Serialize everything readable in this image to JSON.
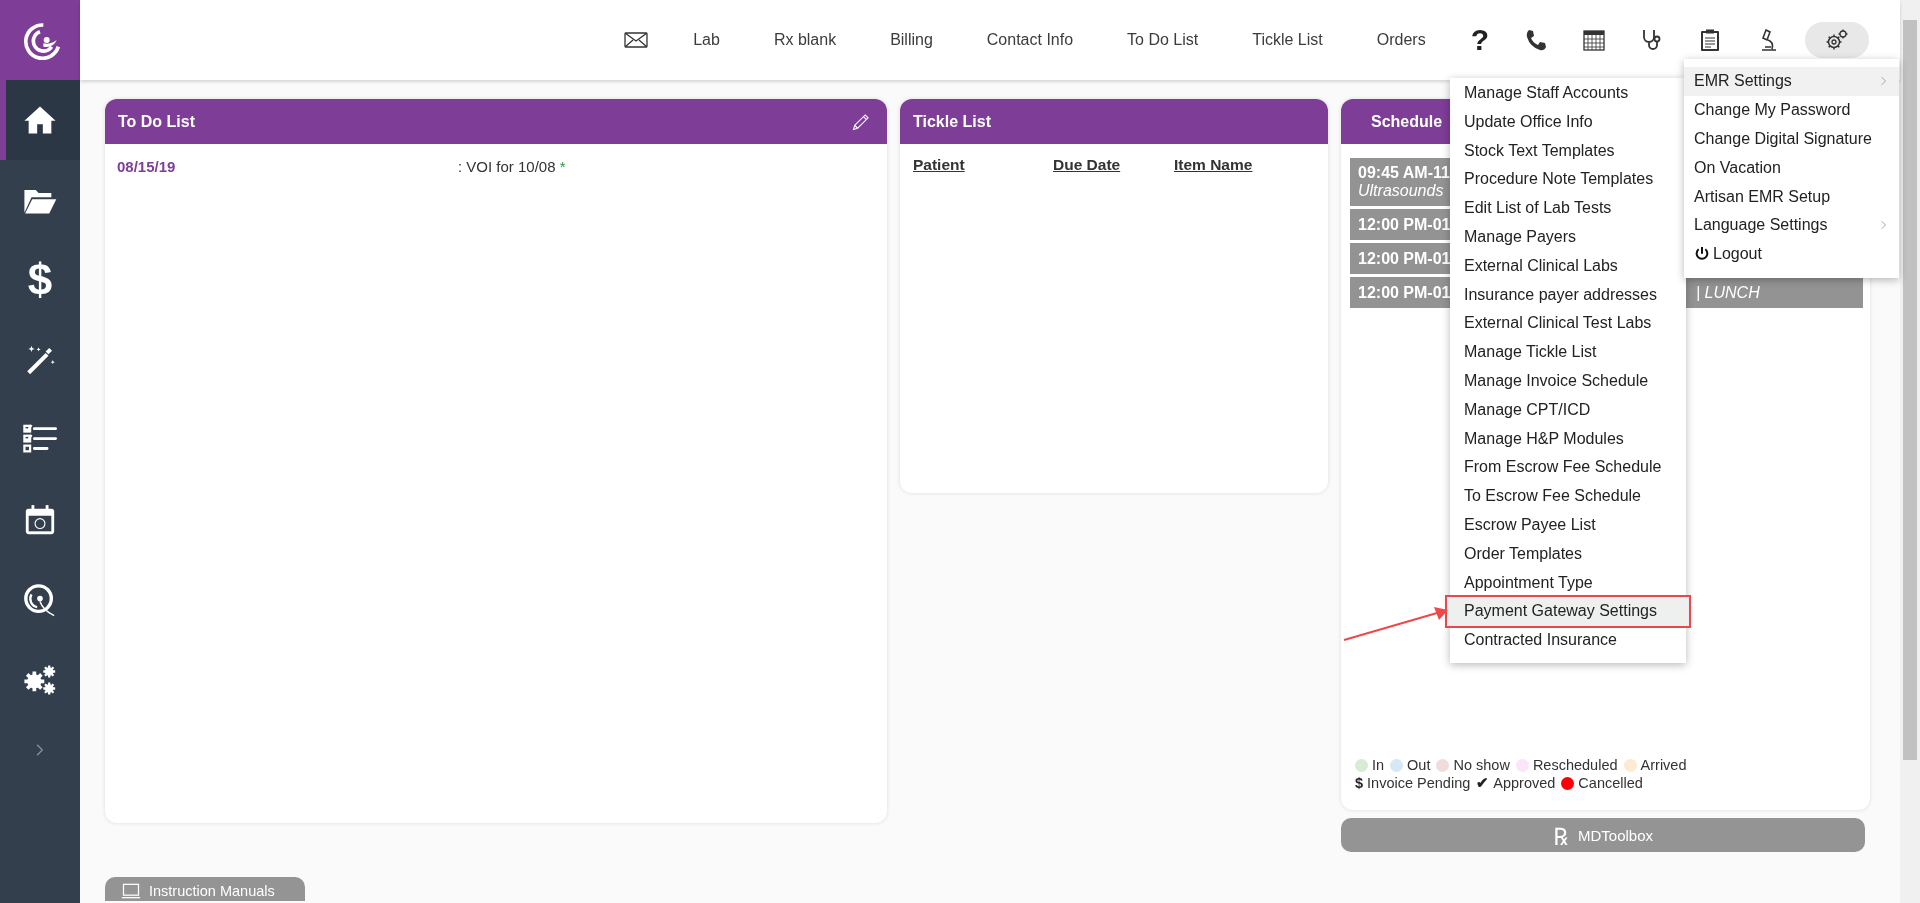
{
  "sidebar": {
    "items": [
      {
        "kind": "icon",
        "selected": true
      },
      {
        "kind": "icon",
        "selected": false
      },
      {
        "kind": "glyph",
        "glyph": "$",
        "selected": false
      },
      {
        "kind": "icon",
        "selected": false
      },
      {
        "kind": "icon",
        "selected": false
      },
      {
        "kind": "icon",
        "selected": false
      },
      {
        "kind": "icon",
        "selected": false
      },
      {
        "kind": "icon",
        "selected": false
      }
    ]
  },
  "top_nav": {
    "items": [
      {
        "kind": "icon",
        "selected": false
      },
      {
        "kind": "link",
        "label": "Lab"
      },
      {
        "kind": "link",
        "label": "Rx blank"
      },
      {
        "kind": "link",
        "label": "Billing"
      },
      {
        "kind": "link",
        "label": "Contact Info"
      },
      {
        "kind": "link",
        "label": "To Do List"
      },
      {
        "kind": "link",
        "label": "Tickle List"
      },
      {
        "kind": "link",
        "label": "Orders"
      },
      {
        "kind": "glyph",
        "label": "?"
      },
      {
        "kind": "icon",
        "selected": false
      },
      {
        "kind": "icon",
        "selected": false
      },
      {
        "kind": "icon",
        "selected": false
      },
      {
        "kind": "icon",
        "selected": false
      },
      {
        "kind": "icon",
        "selected": false
      },
      {
        "kind": "icon",
        "selected": true
      }
    ]
  },
  "todo_list": {
    "title": "To Do List",
    "rows": [
      {
        "date": "08/15/19",
        "text": ": VOI for 10/08",
        "mark": "*"
      }
    ]
  },
  "tickle_list": {
    "title": "Tickle List",
    "columns": [
      "Patient",
      "Due Date",
      "Item Name"
    ]
  },
  "schedule": {
    "title": "Schedule",
    "appointments": [
      {
        "time": "09:45 AM-11",
        "detail": "Ultrasounds"
      },
      {
        "time": "12:00 PM-01"
      },
      {
        "time": "12:00 PM-01"
      },
      {
        "time": "12:00 PM-01",
        "tail": "| LUNCH"
      }
    ],
    "legend": {
      "statuses": [
        {
          "label": "In",
          "color": "#d7ecd3"
        },
        {
          "label": "Out",
          "color": "#d4e9f5"
        },
        {
          "label": "No show",
          "color": "#f1dcdc"
        },
        {
          "label": "Rescheduled",
          "color": "#fbe5f8"
        },
        {
          "label": "Arrived",
          "color": "#fcebd2"
        }
      ],
      "markers": [
        {
          "kind": "glyph",
          "glyph": "$",
          "label": "Invoice Pending"
        },
        {
          "kind": "glyph",
          "glyph": "✔",
          "label": "Approved"
        },
        {
          "kind": "dot",
          "color": "#ff0000",
          "label": "Cancelled"
        }
      ]
    }
  },
  "mdtoolbox_button": {
    "glyph": "℞",
    "label": "MDToolbox"
  },
  "instruction_manuals_button": {
    "label": "Instruction Manuals"
  },
  "settings_menu": {
    "items": [
      {
        "label": "EMR Settings",
        "submenu": true,
        "expanded": true
      },
      {
        "label": "Change My Password",
        "submenu": false,
        "expanded": false
      },
      {
        "label": "Change Digital Signature",
        "submenu": false,
        "expanded": false
      },
      {
        "label": "On Vacation",
        "submenu": false,
        "expanded": false
      },
      {
        "label": "Artisan EMR Setup",
        "submenu": false,
        "expanded": false
      },
      {
        "label": "Language Settings",
        "submenu": true,
        "expanded": false
      },
      {
        "label": "Logout",
        "kind": "logout",
        "submenu": false,
        "expanded": false
      }
    ]
  },
  "emr_settings_menu": {
    "items": [
      {
        "label": "Manage Staff Accounts",
        "selected": false
      },
      {
        "label": "Update Office Info",
        "selected": false
      },
      {
        "label": "Stock Text Templates",
        "selected": false
      },
      {
        "label": "Procedure Note Templates",
        "selected": false
      },
      {
        "label": "Edit List of Lab Tests",
        "selected": false
      },
      {
        "label": "Manage Payers",
        "selected": false
      },
      {
        "label": "External Clinical Labs",
        "selected": false
      },
      {
        "label": "Insurance payer addresses",
        "selected": false
      },
      {
        "label": "External Clinical Test Labs",
        "selected": false
      },
      {
        "label": "Manage Tickle List",
        "selected": false
      },
      {
        "label": "Manage Invoice Schedule",
        "selected": false
      },
      {
        "label": "Manage CPT/ICD",
        "selected": false
      },
      {
        "label": "Manage H&P Modules",
        "selected": false
      },
      {
        "label": "From Escrow Fee Schedule",
        "selected": false
      },
      {
        "label": "To Escrow Fee Schedule",
        "selected": false
      },
      {
        "label": "Escrow Payee List",
        "selected": false
      },
      {
        "label": "Order Templates",
        "selected": false
      },
      {
        "label": "Appointment Type",
        "selected": false
      },
      {
        "label": "Payment Gateway Settings",
        "selected": true
      },
      {
        "label": "Contracted Insurance",
        "selected": false
      }
    ]
  }
}
